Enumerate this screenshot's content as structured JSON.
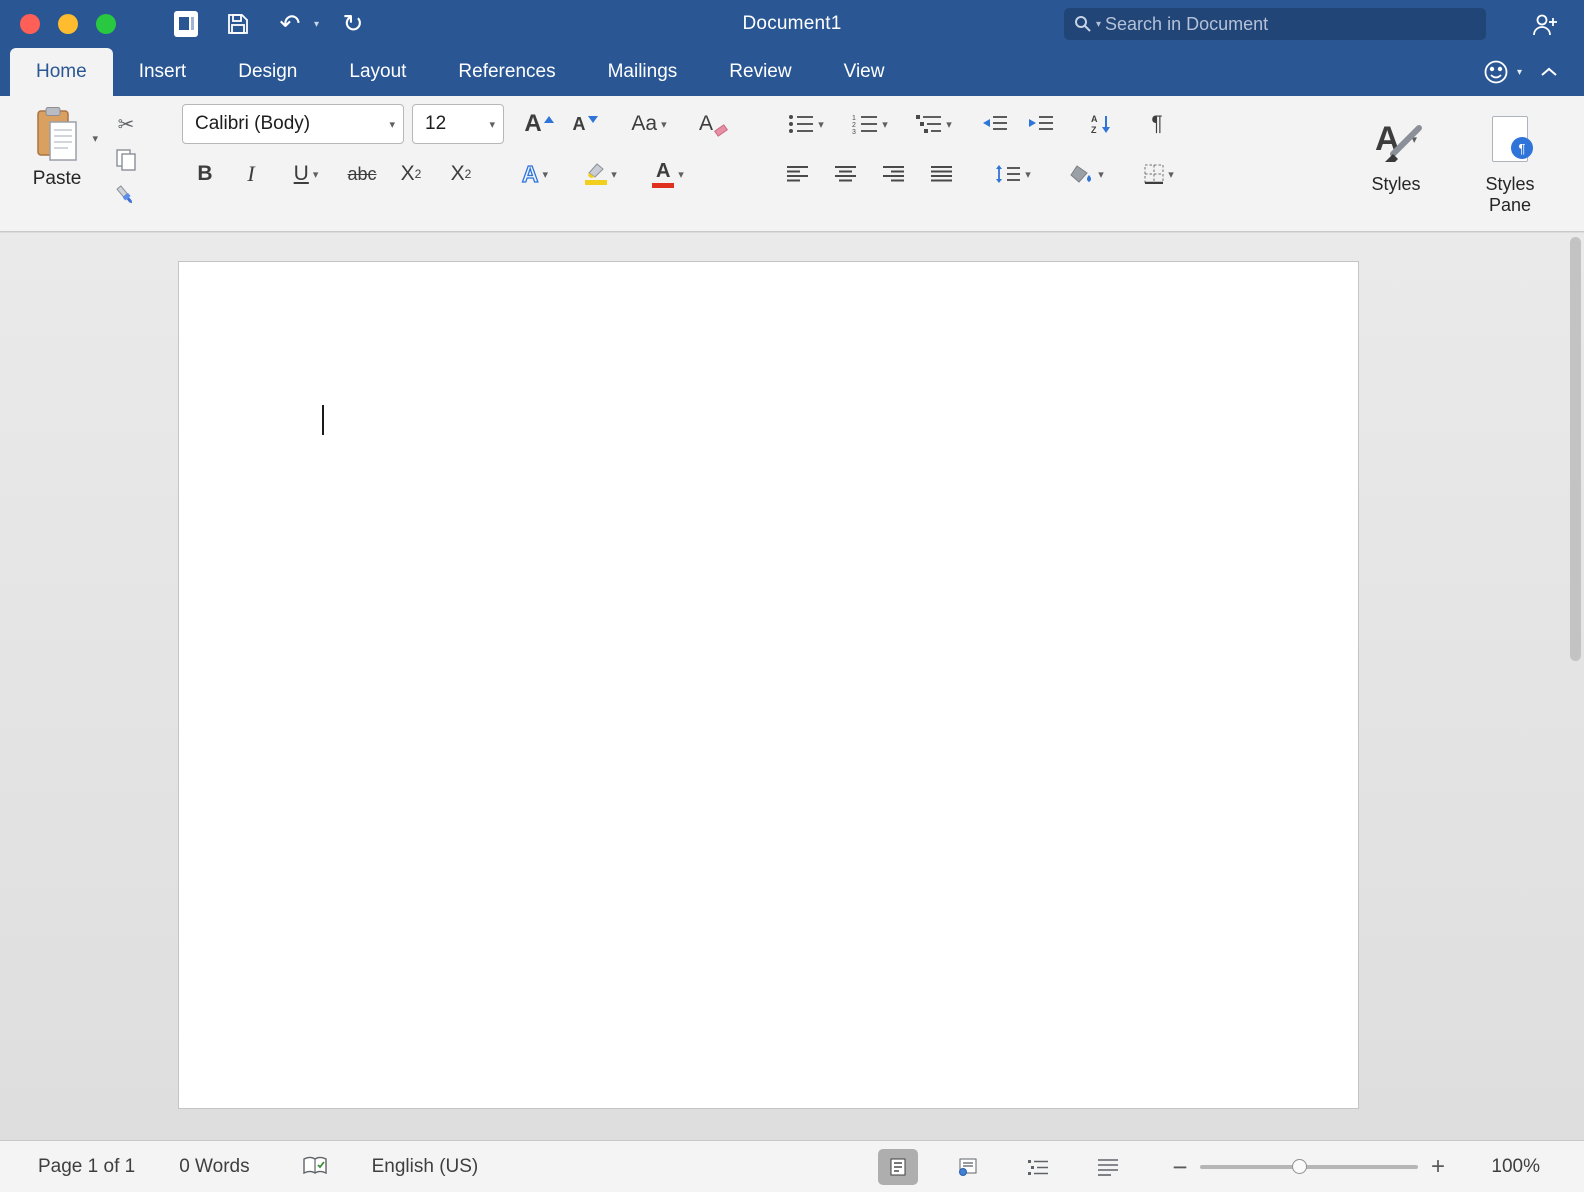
{
  "titlebar": {
    "title": "Document1",
    "search_placeholder": "Search in Document"
  },
  "tabs": [
    {
      "label": "Home",
      "active": true
    },
    {
      "label": "Insert",
      "active": false
    },
    {
      "label": "Design",
      "active": false
    },
    {
      "label": "Layout",
      "active": false
    },
    {
      "label": "References",
      "active": false
    },
    {
      "label": "Mailings",
      "active": false
    },
    {
      "label": "Review",
      "active": false
    },
    {
      "label": "View",
      "active": false
    }
  ],
  "ribbon": {
    "clipboard": {
      "paste_label": "Paste"
    },
    "font": {
      "name": "Calibri (Body)",
      "size": "12",
      "grow_glyph": "A",
      "shrink_glyph": "A",
      "change_case_glyph": "Aa",
      "clear_formatting_glyph": "A",
      "bold_glyph": "B",
      "italic_glyph": "I",
      "underline_glyph": "U",
      "strikethrough_glyph": "abc",
      "subscript_glyph": "X",
      "subscript_small": "2",
      "superscript_glyph": "X",
      "superscript_small": "2",
      "text_effects_glyph": "A",
      "font_color_glyph": "A"
    },
    "styles": {
      "styles_label": "Styles",
      "styles_pane_label": "Styles Pane"
    }
  },
  "statusbar": {
    "page_info": "Page 1 of 1",
    "word_count": "0 Words",
    "language": "English (US)",
    "zoom_level": "100%"
  },
  "colors": {
    "titlebar_blue": "#2a5794",
    "accent_blue": "#2e74d9",
    "font_color_red": "#e0301e",
    "highlight_yellow": "#f2cf1d",
    "traffic_red": "#ff5f57",
    "traffic_yellow": "#febc2e",
    "traffic_green": "#28c840"
  }
}
